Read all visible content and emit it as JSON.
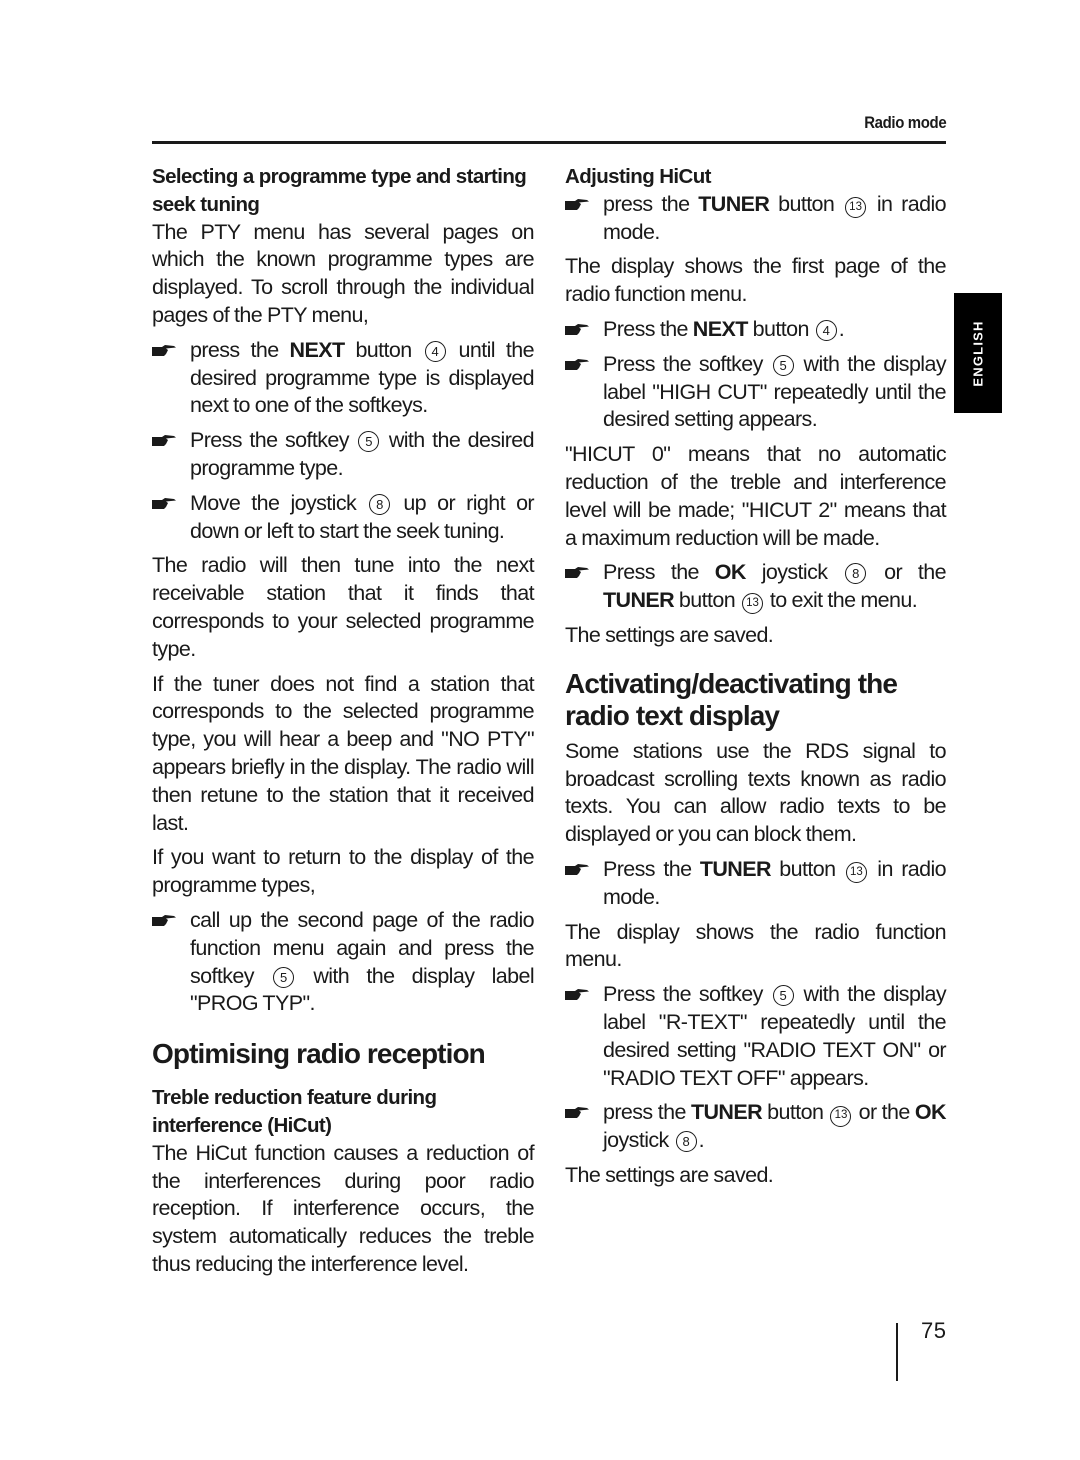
{
  "header": {
    "section_label": "Radio mode"
  },
  "language_tab": {
    "label": "ENGLISH"
  },
  "icons": {
    "bullet": "pointing-hand-icon",
    "reference_number": "circled-number-icon"
  },
  "left_column": [
    {
      "type": "subheading",
      "name": "heading-selecting-programme-type",
      "text": "Selecting a programme type and starting seek tuning"
    },
    {
      "type": "paragraph",
      "segments": [
        {
          "t": "The PTY menu has several pages on which the known programme types are displayed. To scroll through the individual pages of the PTY menu,"
        }
      ]
    },
    {
      "type": "bullet",
      "segments": [
        {
          "t": "press the "
        },
        {
          "b": "NEXT"
        },
        {
          "t": " button "
        },
        {
          "n": "4"
        },
        {
          "t": " until the desired programme type is displayed next to one of the softkeys."
        }
      ]
    },
    {
      "type": "bullet",
      "segments": [
        {
          "t": "Press the softkey "
        },
        {
          "n": "5"
        },
        {
          "t": " with the desired programme type."
        }
      ]
    },
    {
      "type": "bullet",
      "segments": [
        {
          "t": "Move the joystick "
        },
        {
          "n": "8"
        },
        {
          "t": " up or right or down or left to start the seek tuning."
        }
      ]
    },
    {
      "type": "paragraph",
      "segments": [
        {
          "t": "The radio will then tune into the next receivable station that it finds that corresponds to your selected programme type."
        }
      ]
    },
    {
      "type": "paragraph",
      "segments": [
        {
          "t": "If the tuner does not find a station that corresponds to the selected programme type, you will hear a beep and \"NO PTY\" appears briefly in the display. The radio will then retune to the station that it received last."
        }
      ]
    },
    {
      "type": "paragraph",
      "segments": [
        {
          "t": "If you want to return to the display of the programme types,"
        }
      ]
    },
    {
      "type": "bullet",
      "segments": [
        {
          "t": "call up the second page of the radio function menu again and press the softkey "
        },
        {
          "n": "5"
        },
        {
          "t": " with the display label \"PROG TYP\"."
        }
      ]
    },
    {
      "type": "section",
      "name": "heading-optimising-radio-reception",
      "text": "Optimising radio reception"
    },
    {
      "type": "subheading",
      "name": "heading-treble-reduction",
      "text": "Treble reduction feature during interference (HiCut)"
    },
    {
      "type": "paragraph",
      "segments": [
        {
          "t": "The HiCut function causes a reduction of the interferences during poor radio reception. If interference occurs, the system automatically reduces the treble thus reducing the interference level."
        }
      ]
    }
  ],
  "right_column": [
    {
      "type": "subheading",
      "name": "heading-adjusting-hicut",
      "text": "Adjusting HiCut"
    },
    {
      "type": "bullet",
      "segments": [
        {
          "t": "press the "
        },
        {
          "b": "TUNER"
        },
        {
          "t": " button "
        },
        {
          "n": "13"
        },
        {
          "t": " in radio mode."
        }
      ]
    },
    {
      "type": "paragraph",
      "segments": [
        {
          "t": "The display shows the first page of the radio function menu."
        }
      ]
    },
    {
      "type": "bullet",
      "segments": [
        {
          "t": "Press the "
        },
        {
          "b": "NEXT"
        },
        {
          "t": " button "
        },
        {
          "n": "4"
        },
        {
          "t": "."
        }
      ]
    },
    {
      "type": "bullet",
      "segments": [
        {
          "t": "Press the softkey "
        },
        {
          "n": "5"
        },
        {
          "t": " with the display label \"HIGH CUT\" repeatedly until the desired setting appears."
        }
      ]
    },
    {
      "type": "paragraph",
      "segments": [
        {
          "t": "\"HICUT 0\" means that no automatic reduction of the treble and interference level will be made; \"HICUT 2\" means that a maximum reduction will be made."
        }
      ]
    },
    {
      "type": "bullet",
      "segments": [
        {
          "t": "Press the "
        },
        {
          "b": "OK"
        },
        {
          "t": " joystick "
        },
        {
          "n": "8"
        },
        {
          "t": " or the "
        },
        {
          "b": "TUNER"
        },
        {
          "t": " button "
        },
        {
          "n": "13"
        },
        {
          "t": " to exit the menu."
        }
      ]
    },
    {
      "type": "paragraph",
      "segments": [
        {
          "t": "The settings are saved."
        }
      ]
    },
    {
      "type": "section",
      "name": "heading-activating-radio-text",
      "text": "Activating/deactivating the radio text display"
    },
    {
      "type": "paragraph",
      "segments": [
        {
          "t": "Some stations use the RDS signal to broadcast scrolling texts known as radio texts. You can allow radio texts to be displayed or you can block them."
        }
      ]
    },
    {
      "type": "bullet",
      "segments": [
        {
          "t": "Press the "
        },
        {
          "b": "TUNER"
        },
        {
          "t": " button "
        },
        {
          "n": "13"
        },
        {
          "t": " in radio mode."
        }
      ]
    },
    {
      "type": "paragraph",
      "segments": [
        {
          "t": "The display shows the radio function menu."
        }
      ]
    },
    {
      "type": "bullet",
      "segments": [
        {
          "t": "Press the softkey "
        },
        {
          "n": "5"
        },
        {
          "t": " with the display label \"R-TEXT\" repeatedly until the desired setting \"RADIO TEXT ON\" or \"RADIO TEXT OFF\" appears."
        }
      ]
    },
    {
      "type": "bullet",
      "segments": [
        {
          "t": "press the "
        },
        {
          "b": "TUNER"
        },
        {
          "t": " button "
        },
        {
          "n": "13"
        },
        {
          "t": " or the "
        },
        {
          "b": "OK"
        },
        {
          "t": " joystick "
        },
        {
          "n": "8"
        },
        {
          "t": "."
        }
      ]
    },
    {
      "type": "paragraph",
      "segments": [
        {
          "t": "The settings are saved."
        }
      ]
    }
  ],
  "footer": {
    "page_number": "75"
  }
}
